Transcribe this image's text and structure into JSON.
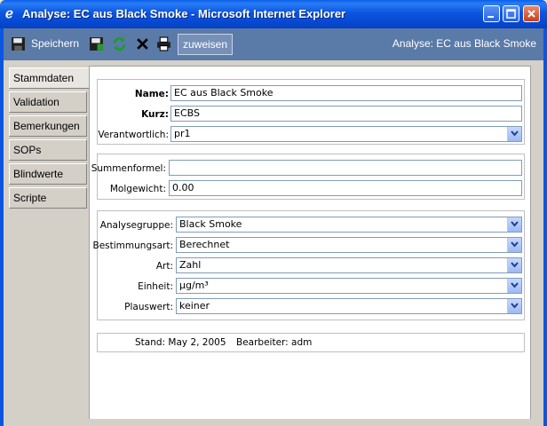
{
  "window": {
    "title": "Analyse: EC aus Black Smoke - Microsoft Internet Explorer",
    "icon": "ie-icon",
    "controls": [
      "minimize-icon",
      "maximize-icon",
      "close-icon"
    ]
  },
  "toolbar": {
    "save_label": "Speichern",
    "icons": [
      "save-icon",
      "save-green-icon",
      "refresh-icon",
      "delete-icon",
      "print-icon"
    ],
    "assign_label": "zuweisen",
    "title": "Analyse: EC aus Black Smoke"
  },
  "tabs": [
    {
      "label": "Stammdaten",
      "active": true
    },
    {
      "label": "Validation",
      "active": false
    },
    {
      "label": "Bemerkungen",
      "active": false
    },
    {
      "label": "SOPs",
      "active": false
    },
    {
      "label": "Blindwerte",
      "active": false
    },
    {
      "label": "Scripte",
      "active": false
    }
  ],
  "stammdaten": {
    "name_label": "Name:",
    "name_value": "EC aus Black Smoke",
    "kurz_label": "Kurz:",
    "kurz_value": "ECBS",
    "verantwortlich_label": "Verantwortlich:",
    "verantwortlich_value": "pr1"
  },
  "formel": {
    "summenformel_label": "Summenformel:",
    "summenformel_value": "",
    "molgewicht_label": "Molgewicht:",
    "molgewicht_value": "0.00"
  },
  "analyse": {
    "gruppe_label": "Analysegruppe:",
    "gruppe_value": "Black Smoke",
    "bestimmungsart_label": "Bestimmungsart:",
    "bestimmungsart_value": "Berechnet",
    "art_label": "Art:",
    "art_value": "Zahl",
    "einheit_label": "Einheit:",
    "einheit_value": "µg/m³",
    "plauswert_label": "Plauswert:",
    "plauswert_value": "keiner"
  },
  "status": {
    "stand": "Stand:  May 2, 2005",
    "bearbeiter": "Bearbeiter:  adm"
  },
  "colors": {
    "titlebar": "#0b56e0",
    "toolbar": "#5a7aa8",
    "panel_bg": "#d4d0c8"
  }
}
